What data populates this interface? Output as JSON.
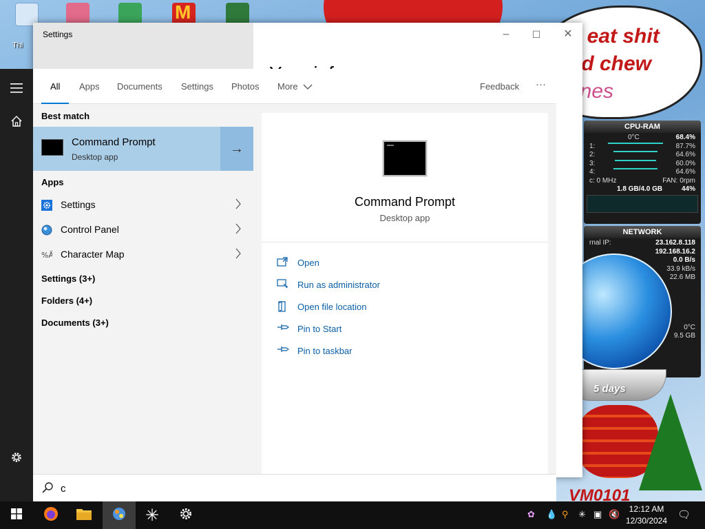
{
  "desktop": {
    "icon_label_partial": "Thi",
    "speech_lines": [
      "o eat shit",
      "nd chew",
      "anes"
    ],
    "cpu_gadget": {
      "title": "CPU-RAM",
      "temp": "0°C",
      "total": "68.4%",
      "cores": [
        {
          "label": "1:",
          "value": "87.7%"
        },
        {
          "label": "2:",
          "value": "64.6%"
        },
        {
          "label": "3:",
          "value": "60.0%"
        },
        {
          "label": "4:",
          "value": "64.6%"
        }
      ],
      "freq": "c: 0 MHz",
      "fan": "FAN: 0rpm",
      "ram": "1.8 GB/4.0 GB",
      "ram_pct": "44%"
    },
    "net_gadget": {
      "title": "NETWORK",
      "external_label": "rnal IP:",
      "external_ip": "23.162.8.118",
      "internal_ip": "192.168.16.2",
      "rate1": "0.0 B/s",
      "rate2": "33.9 kB/s",
      "rate3": "22.6 MB",
      "temp": "0°C",
      "size": "9.5 GB"
    },
    "globe_text": "5 days",
    "vm_text": "VM0101"
  },
  "settings_window": {
    "title": "Settings",
    "heading_partial": "Your inf"
  },
  "start_rail": {
    "icons": [
      "hamburger-icon",
      "home-icon",
      "gear-icon"
    ]
  },
  "search": {
    "tabs": [
      "All",
      "Apps",
      "Documents",
      "Settings",
      "Photos",
      "More"
    ],
    "active_tab": "All",
    "feedback_label": "Feedback",
    "more_dots": "···",
    "best_match_header": "Best match",
    "best_match": {
      "title": "Command Prompt",
      "subtitle": "Desktop app"
    },
    "apps_header": "Apps",
    "apps": [
      {
        "label": "Settings",
        "icon": "settings-gear-icon"
      },
      {
        "label": "Control Panel",
        "icon": "control-panel-icon"
      },
      {
        "label": "Character Map",
        "icon": "character-map-icon"
      }
    ],
    "categories": [
      "Settings (3+)",
      "Folders (4+)",
      "Documents (3+)"
    ],
    "preview": {
      "title": "Command Prompt",
      "subtitle": "Desktop app",
      "actions": [
        {
          "label": "Open",
          "icon": "open-icon"
        },
        {
          "label": "Run as administrator",
          "icon": "run-as-admin-icon"
        },
        {
          "label": "Open file location",
          "icon": "file-location-icon"
        },
        {
          "label": "Pin to Start",
          "icon": "pin-icon"
        },
        {
          "label": "Pin to taskbar",
          "icon": "pin-icon"
        }
      ]
    },
    "query": "c"
  },
  "taskbar": {
    "time": "12:12 AM",
    "date": "12/30/2024"
  },
  "colors": {
    "accent": "#0078d7",
    "selection": "#aacde8",
    "link": "#0b5fa8"
  }
}
